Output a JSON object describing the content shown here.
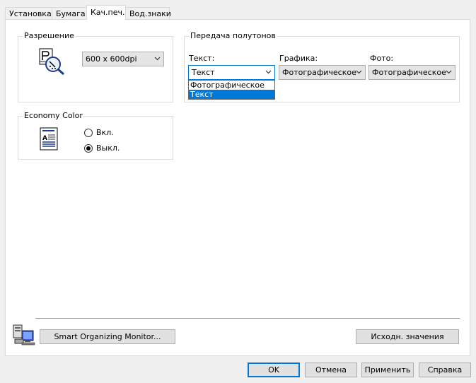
{
  "tabs": [
    {
      "label": "Установка"
    },
    {
      "label": "Бумага"
    },
    {
      "label": "Кач.печ."
    },
    {
      "label": "Вод.знаки"
    }
  ],
  "resolution": {
    "title": "Разрешение",
    "value": "600 x 600dpi",
    "icon": "printer-magnifier-icon"
  },
  "halftone": {
    "title": "Передача полутонов",
    "text_label": "Текст:",
    "text_value": "Текст",
    "text_options": [
      "Фотографическое",
      "Текст"
    ],
    "graphics_label": "Графика:",
    "graphics_value": "Фотографическое",
    "photo_label": "Фото:",
    "photo_value": "Фотографическое"
  },
  "economy": {
    "title": "Economy Color",
    "on_label": "Вкл.",
    "off_label": "Выкл.",
    "selected": "off",
    "icon": "document-icon"
  },
  "monitor": {
    "button_label": "Smart Organizing Monitor...",
    "icon": "computer-printer-icon"
  },
  "defaults_button": "Исходн. значения",
  "footer": {
    "ok": "OK",
    "cancel": "Отмена",
    "apply": "Применить",
    "help": "Справка"
  },
  "colors": {
    "accent": "#0078d7",
    "panel": "#ffffff",
    "window": "#f0f0f0"
  }
}
